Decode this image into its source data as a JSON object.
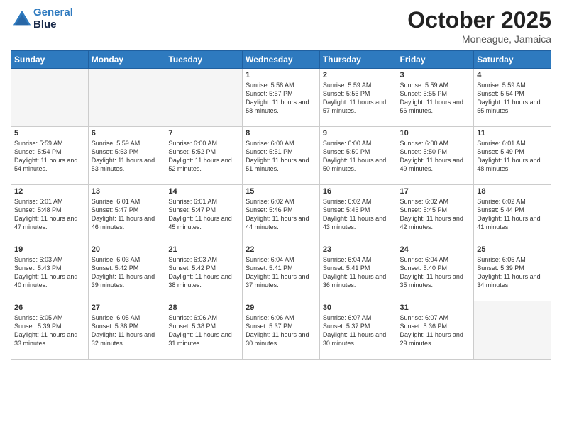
{
  "header": {
    "logo_line1": "General",
    "logo_line2": "Blue",
    "month": "October 2025",
    "location": "Moneague, Jamaica"
  },
  "weekdays": [
    "Sunday",
    "Monday",
    "Tuesday",
    "Wednesday",
    "Thursday",
    "Friday",
    "Saturday"
  ],
  "weeks": [
    [
      {
        "day": "",
        "empty": true
      },
      {
        "day": "",
        "empty": true
      },
      {
        "day": "",
        "empty": true
      },
      {
        "day": "1",
        "sunrise": "5:58 AM",
        "sunset": "5:57 PM",
        "daylight": "11 hours and 58 minutes."
      },
      {
        "day": "2",
        "sunrise": "5:59 AM",
        "sunset": "5:56 PM",
        "daylight": "11 hours and 57 minutes."
      },
      {
        "day": "3",
        "sunrise": "5:59 AM",
        "sunset": "5:55 PM",
        "daylight": "11 hours and 56 minutes."
      },
      {
        "day": "4",
        "sunrise": "5:59 AM",
        "sunset": "5:54 PM",
        "daylight": "11 hours and 55 minutes."
      }
    ],
    [
      {
        "day": "5",
        "sunrise": "5:59 AM",
        "sunset": "5:54 PM",
        "daylight": "11 hours and 54 minutes."
      },
      {
        "day": "6",
        "sunrise": "5:59 AM",
        "sunset": "5:53 PM",
        "daylight": "11 hours and 53 minutes."
      },
      {
        "day": "7",
        "sunrise": "6:00 AM",
        "sunset": "5:52 PM",
        "daylight": "11 hours and 52 minutes."
      },
      {
        "day": "8",
        "sunrise": "6:00 AM",
        "sunset": "5:51 PM",
        "daylight": "11 hours and 51 minutes."
      },
      {
        "day": "9",
        "sunrise": "6:00 AM",
        "sunset": "5:50 PM",
        "daylight": "11 hours and 50 minutes."
      },
      {
        "day": "10",
        "sunrise": "6:00 AM",
        "sunset": "5:50 PM",
        "daylight": "11 hours and 49 minutes."
      },
      {
        "day": "11",
        "sunrise": "6:01 AM",
        "sunset": "5:49 PM",
        "daylight": "11 hours and 48 minutes."
      }
    ],
    [
      {
        "day": "12",
        "sunrise": "6:01 AM",
        "sunset": "5:48 PM",
        "daylight": "11 hours and 47 minutes."
      },
      {
        "day": "13",
        "sunrise": "6:01 AM",
        "sunset": "5:47 PM",
        "daylight": "11 hours and 46 minutes."
      },
      {
        "day": "14",
        "sunrise": "6:01 AM",
        "sunset": "5:47 PM",
        "daylight": "11 hours and 45 minutes."
      },
      {
        "day": "15",
        "sunrise": "6:02 AM",
        "sunset": "5:46 PM",
        "daylight": "11 hours and 44 minutes."
      },
      {
        "day": "16",
        "sunrise": "6:02 AM",
        "sunset": "5:45 PM",
        "daylight": "11 hours and 43 minutes."
      },
      {
        "day": "17",
        "sunrise": "6:02 AM",
        "sunset": "5:45 PM",
        "daylight": "11 hours and 42 minutes."
      },
      {
        "day": "18",
        "sunrise": "6:02 AM",
        "sunset": "5:44 PM",
        "daylight": "11 hours and 41 minutes."
      }
    ],
    [
      {
        "day": "19",
        "sunrise": "6:03 AM",
        "sunset": "5:43 PM",
        "daylight": "11 hours and 40 minutes."
      },
      {
        "day": "20",
        "sunrise": "6:03 AM",
        "sunset": "5:42 PM",
        "daylight": "11 hours and 39 minutes."
      },
      {
        "day": "21",
        "sunrise": "6:03 AM",
        "sunset": "5:42 PM",
        "daylight": "11 hours and 38 minutes."
      },
      {
        "day": "22",
        "sunrise": "6:04 AM",
        "sunset": "5:41 PM",
        "daylight": "11 hours and 37 minutes."
      },
      {
        "day": "23",
        "sunrise": "6:04 AM",
        "sunset": "5:41 PM",
        "daylight": "11 hours and 36 minutes."
      },
      {
        "day": "24",
        "sunrise": "6:04 AM",
        "sunset": "5:40 PM",
        "daylight": "11 hours and 35 minutes."
      },
      {
        "day": "25",
        "sunrise": "6:05 AM",
        "sunset": "5:39 PM",
        "daylight": "11 hours and 34 minutes."
      }
    ],
    [
      {
        "day": "26",
        "sunrise": "6:05 AM",
        "sunset": "5:39 PM",
        "daylight": "11 hours and 33 minutes."
      },
      {
        "day": "27",
        "sunrise": "6:05 AM",
        "sunset": "5:38 PM",
        "daylight": "11 hours and 32 minutes."
      },
      {
        "day": "28",
        "sunrise": "6:06 AM",
        "sunset": "5:38 PM",
        "daylight": "11 hours and 31 minutes."
      },
      {
        "day": "29",
        "sunrise": "6:06 AM",
        "sunset": "5:37 PM",
        "daylight": "11 hours and 30 minutes."
      },
      {
        "day": "30",
        "sunrise": "6:07 AM",
        "sunset": "5:37 PM",
        "daylight": "11 hours and 30 minutes."
      },
      {
        "day": "31",
        "sunrise": "6:07 AM",
        "sunset": "5:36 PM",
        "daylight": "11 hours and 29 minutes."
      },
      {
        "day": "",
        "empty": true
      }
    ]
  ],
  "labels": {
    "sunrise": "Sunrise:",
    "sunset": "Sunset:",
    "daylight": "Daylight:"
  }
}
